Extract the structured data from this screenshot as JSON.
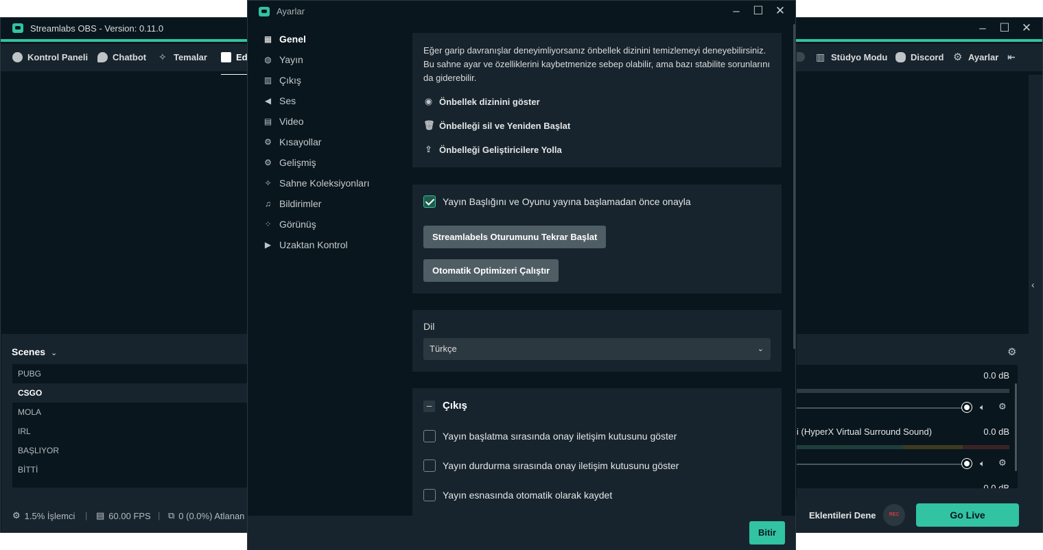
{
  "main_window": {
    "title": "Streamlabs OBS - Version: 0.11.0",
    "nav": {
      "dashboard": "Kontrol Paneli",
      "chatbot": "Chatbot",
      "themes": "Temalar",
      "editor": "Edi",
      "studio_mode": "Stüdyo Modu",
      "discord": "Discord",
      "settings": "Ayarlar"
    },
    "scenes": {
      "header": "Scenes",
      "items": [
        "PUBG",
        "CSGO",
        "MOLA",
        "IRL",
        "BAŞLIYOR",
        "BİTTİ"
      ],
      "selected_index": 1
    },
    "mixer": {
      "items": [
        {
          "name": "",
          "db": "0.0 dB"
        },
        {
          "name": "i (HyperX Virtual Surround Sound)",
          "db": "0.0 dB"
        },
        {
          "name": "",
          "db": "0.0 dB"
        }
      ]
    },
    "footer": {
      "cpu": "1.5% İşlemci",
      "fps": "60.00 FPS",
      "dropped": "0 (0.0%) Atlanan",
      "extensions": "Eklentileri Dene",
      "rec": "REC",
      "go_live": "Go Live"
    }
  },
  "settings_dialog": {
    "title": "Ayarlar",
    "sidebar": [
      {
        "label": "Genel",
        "icon": "grid-icon",
        "active": true
      },
      {
        "label": "Yayın",
        "icon": "globe-icon",
        "active": false
      },
      {
        "label": "Çıkış",
        "icon": "output-icon",
        "active": false
      },
      {
        "label": "Ses",
        "icon": "speaker-icon",
        "active": false
      },
      {
        "label": "Video",
        "icon": "film-icon",
        "active": false
      },
      {
        "label": "Kısayollar",
        "icon": "gear-icon",
        "active": false
      },
      {
        "label": "Gelişmiş",
        "icon": "gears-icon",
        "active": false
      },
      {
        "label": "Sahne Koleksiyonları",
        "icon": "magic-wand-icon",
        "active": false
      },
      {
        "label": "Bildirimler",
        "icon": "bell-icon",
        "active": false
      },
      {
        "label": "Görünüş",
        "icon": "palette-icon",
        "active": false
      },
      {
        "label": "Uzaktan Kontrol",
        "icon": "play-circle-icon",
        "active": false
      }
    ],
    "cache": {
      "description": "Eğer garip davranışlar deneyimliyorsanız önbellek dizinini temizlemeyi deneyebilirsiniz. Bu sahne ayar ve özelliklerini kaybetmenize sebep olabilir, ama bazı stabilite sorunlarını da giderebilir.",
      "show_dir": "Önbellek dizinini göster",
      "delete_restart": "Önbelleği sil ve Yeniden Başlat",
      "upload": "Önbelleği Geliştiricilere Yolla"
    },
    "stream": {
      "confirm_title_game": "Yayın Başlığını ve Oyunu yayına başlamadan önce onayla",
      "confirm_title_game_checked": true,
      "restart_streamlabels": "Streamlabels Oturumunu Tekrar Başlat",
      "run_optimizer": "Otomatik Optimizeri Çalıştır"
    },
    "language": {
      "label": "Dil",
      "selected": "Türkçe"
    },
    "output": {
      "title": "Çıkış",
      "collapse_symbol": "–",
      "options": [
        {
          "label": "Yayın başlatma sırasında onay iletişim kutusunu göster",
          "checked": false
        },
        {
          "label": "Yayın durdurma sırasında onay iletişim kutusunu göster",
          "checked": false
        },
        {
          "label": "Yayın esnasında otomatik olarak kaydet",
          "checked": false
        }
      ]
    },
    "done": "Bitir"
  },
  "colors": {
    "accent": "#31c3a2",
    "panel": "#17242d",
    "background": "#09161d",
    "rec": "#d33a3a"
  }
}
